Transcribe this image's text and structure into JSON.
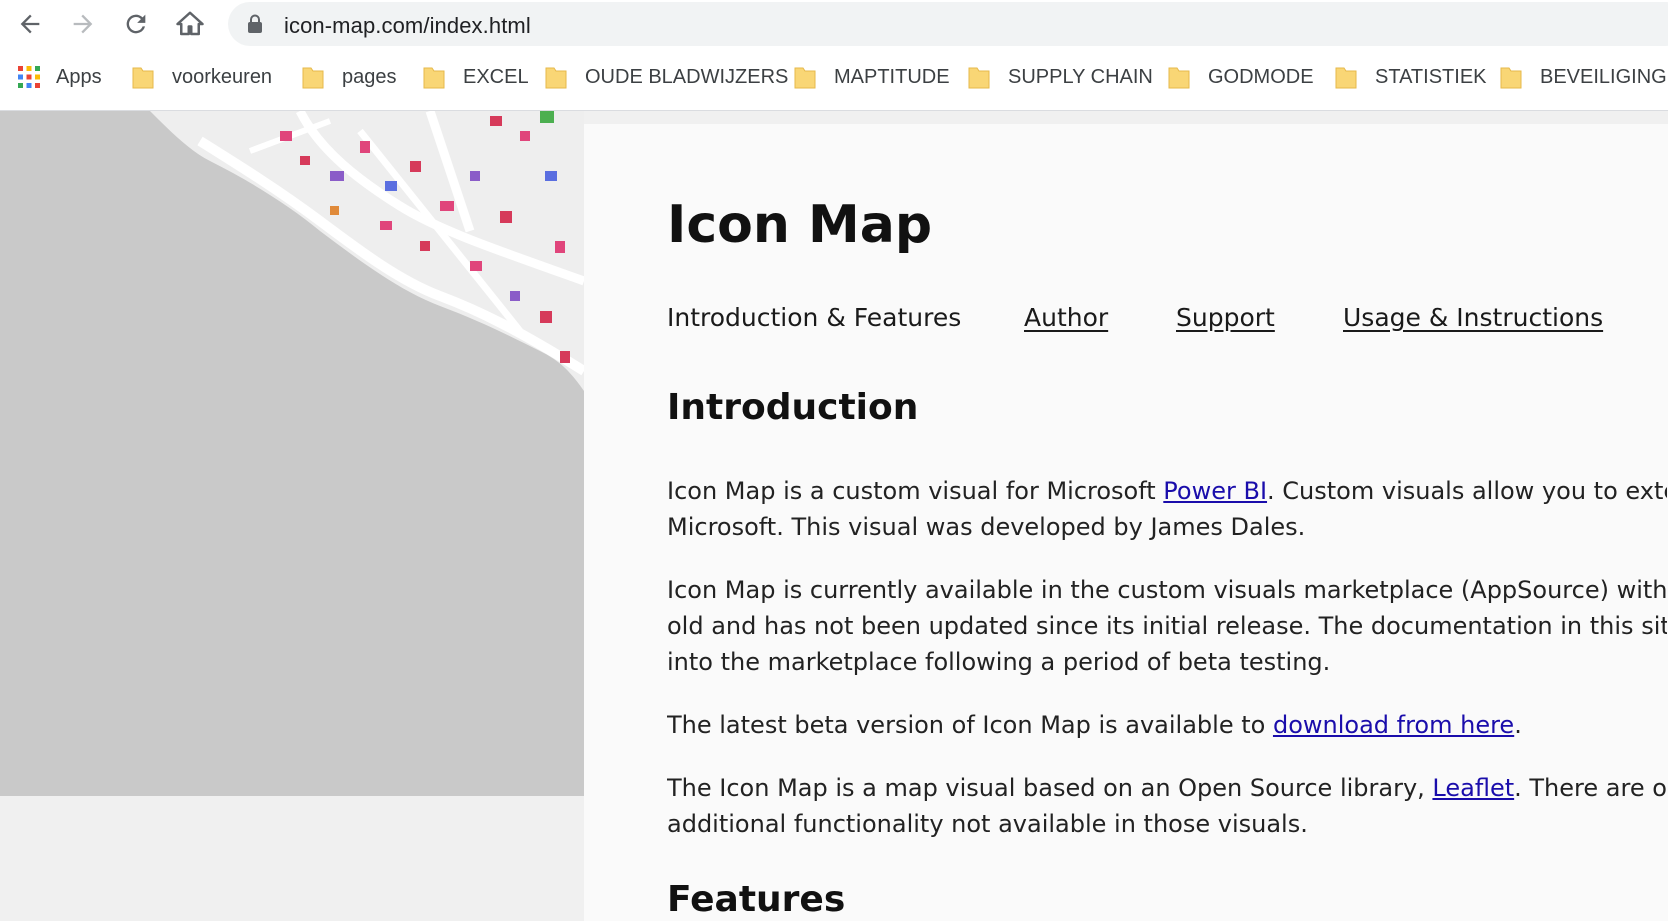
{
  "browser": {
    "url": "icon-map.com/index.html",
    "bookmarks": [
      {
        "label": "Apps",
        "icon": "apps-grid-icon"
      },
      {
        "label": "voorkeuren",
        "icon": "folder-icon"
      },
      {
        "label": "pages",
        "icon": "folder-icon"
      },
      {
        "label": "EXCEL",
        "icon": "folder-icon"
      },
      {
        "label": "OUDE BLADWIJZERS",
        "icon": "folder-icon"
      },
      {
        "label": "MAPTITUDE",
        "icon": "folder-icon"
      },
      {
        "label": "SUPPLY CHAIN",
        "icon": "folder-icon"
      },
      {
        "label": "GODMODE",
        "icon": "folder-icon"
      },
      {
        "label": "STATISTIEK",
        "icon": "folder-icon"
      },
      {
        "label": "BEVEILIGING",
        "icon": "folder-icon"
      }
    ]
  },
  "page": {
    "title": "Icon Map",
    "nav": [
      {
        "label": "Introduction & Features"
      },
      {
        "label": "Author"
      },
      {
        "label": "Support"
      },
      {
        "label": "Usage & Instructions"
      }
    ],
    "intro_heading": "Introduction",
    "p1": {
      "pre": "Icon Map is a custom visual for Microsoft ",
      "link": "Power BI",
      "post": ". Custom visuals allow you to exter",
      "line2": "Microsoft. This visual was developed by James Dales."
    },
    "p2": {
      "line1": "Icon Map is currently available in the custom visuals marketplace (AppSource) within",
      "line2": "old and has not been updated since its initial release. The documentation in this site",
      "line3": "into the marketplace following a period of beta testing."
    },
    "p3": {
      "pre": "The latest beta version of Icon Map is available to ",
      "link": "download from here",
      "post": "."
    },
    "p4": {
      "pre": "The Icon Map is a map visual based on an Open Source library, ",
      "link": "Leaflet",
      "post": ". There are othe",
      "line2": "additional functionality not available in those visuals."
    },
    "features_heading": "Features"
  },
  "colors": {
    "link": "#1a0dab",
    "omnibox": "#f1f3f4",
    "map_water": "#c9c9c9",
    "folder": "#f9d675"
  }
}
